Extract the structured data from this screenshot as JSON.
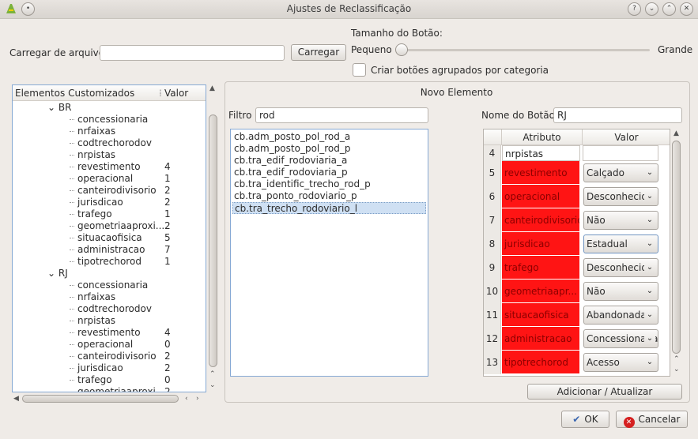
{
  "window": {
    "title": "Ajustes de Reclassificação"
  },
  "top": {
    "load_label": "Carregar de arquivo",
    "load_value": "",
    "load_button": "Carregar",
    "size_label": "Tamanho do Botão:",
    "size_small": "Pequeno",
    "size_large": "Grande",
    "group_checkbox_label": "Criar botões agrupados por categoria"
  },
  "tree": {
    "col_elements": "Elementos Customizados",
    "col_value": "Valor",
    "groups": [
      {
        "label": "BR",
        "items": [
          {
            "name": "concessionaria",
            "value": ""
          },
          {
            "name": "nrfaixas",
            "value": ""
          },
          {
            "name": "codtrechorodov",
            "value": ""
          },
          {
            "name": "nrpistas",
            "value": ""
          },
          {
            "name": "revestimento",
            "value": "4"
          },
          {
            "name": "operacional",
            "value": "1"
          },
          {
            "name": "canteirodivisorio",
            "value": "2"
          },
          {
            "name": "jurisdicao",
            "value": "2"
          },
          {
            "name": "trafego",
            "value": "1"
          },
          {
            "name": "geometriaaproxi...",
            "value": "2"
          },
          {
            "name": "situacaofisica",
            "value": "5"
          },
          {
            "name": "administracao",
            "value": "7"
          },
          {
            "name": "tipotrechorod",
            "value": "1"
          }
        ]
      },
      {
        "label": "RJ",
        "items": [
          {
            "name": "concessionaria",
            "value": ""
          },
          {
            "name": "nrfaixas",
            "value": ""
          },
          {
            "name": "codtrechorodov",
            "value": ""
          },
          {
            "name": "nrpistas",
            "value": ""
          },
          {
            "name": "revestimento",
            "value": "4"
          },
          {
            "name": "operacional",
            "value": "0"
          },
          {
            "name": "canteirodivisorio",
            "value": "2"
          },
          {
            "name": "jurisdicao",
            "value": "2"
          },
          {
            "name": "trafego",
            "value": "0"
          },
          {
            "name": "geometriaaproxi",
            "value": "2"
          }
        ]
      }
    ]
  },
  "new_element": {
    "title": "Novo Elemento",
    "filter_label": "Filtro",
    "filter_value": "rod",
    "button_name_label": "Nome do Botão",
    "button_name_value": "RJ",
    "classes": [
      "cb.adm_posto_pol_rod_a",
      "cb.adm_posto_pol_rod_p",
      "cb.tra_edif_rodoviaria_a",
      "cb.tra_edif_rodoviaria_p",
      "cb.tra_identific_trecho_rod_p",
      "cb.tra_ponto_rodoviario_p",
      "cb.tra_trecho_rodoviario_l"
    ],
    "selected_class": "cb.tra_trecho_rodoviario_l",
    "table": {
      "col_attr": "Atributo",
      "col_value": "Valor",
      "rows": [
        {
          "num": "4",
          "attr": "nrpistas",
          "value": "",
          "highlight": false
        },
        {
          "num": "5",
          "attr": "revestimento",
          "value": "Calçado",
          "highlight": true
        },
        {
          "num": "6",
          "attr": "operacional",
          "value": "Desconhecido",
          "highlight": true
        },
        {
          "num": "7",
          "attr": "canteirodivisorio",
          "value": "Não",
          "highlight": true
        },
        {
          "num": "8",
          "attr": "jurisdicao",
          "value": "Estadual",
          "highlight": true
        },
        {
          "num": "9",
          "attr": "trafego",
          "value": "Desconhecido",
          "highlight": true
        },
        {
          "num": "10",
          "attr": "geometriaapr...",
          "value": "Não",
          "highlight": true
        },
        {
          "num": "11",
          "attr": "situacaofisica",
          "value": "Abandonada",
          "highlight": true
        },
        {
          "num": "12",
          "attr": "administracao",
          "value": "Concessionada",
          "highlight": true
        },
        {
          "num": "13",
          "attr": "tipotrechorod",
          "value": "Acesso",
          "highlight": true
        }
      ]
    },
    "add_button": "Adicionar / Atualizar"
  },
  "footer": {
    "ok": "OK",
    "cancel": "Cancelar"
  },
  "colors": {
    "highlight": "#ff1414",
    "selection": "#cfe0f3"
  }
}
